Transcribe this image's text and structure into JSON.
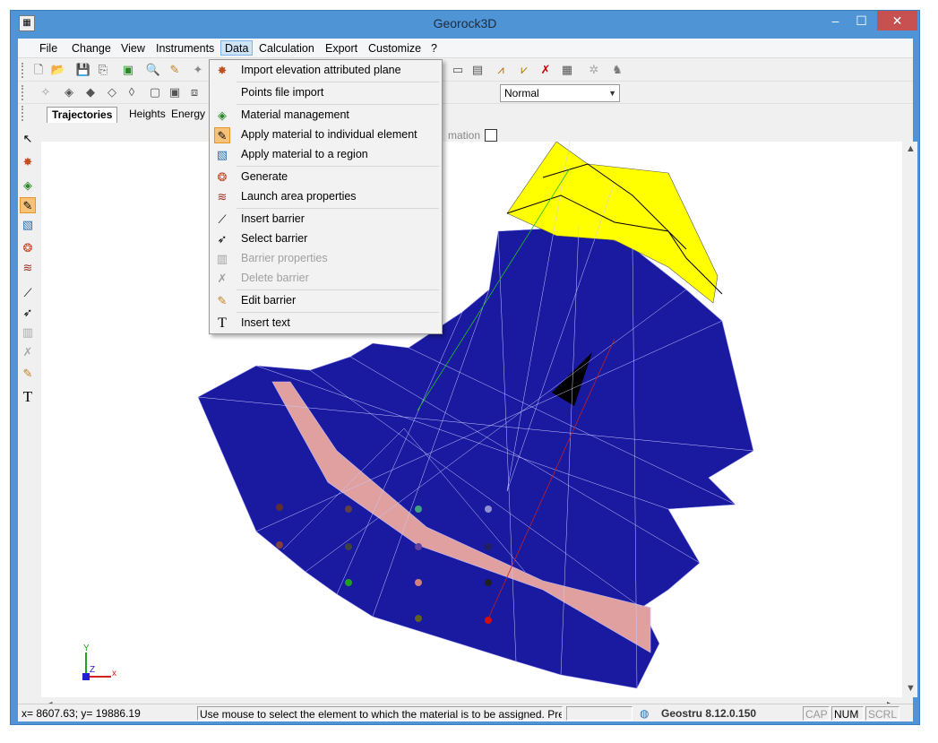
{
  "window": {
    "title": "Georock3D"
  },
  "menubar": [
    "File",
    "Change",
    "View",
    "Instruments",
    "Data",
    "Calculation",
    "Export",
    "Customize",
    "?"
  ],
  "toolbar2": {
    "checkbox_label": "mation",
    "combo_value": "Normal"
  },
  "tabs": [
    "Trajectories",
    "Heights",
    "Energy"
  ],
  "data_menu": {
    "items": [
      {
        "label": "Import elevation attributed plane",
        "icon": "import-plane-icon"
      },
      {
        "label": "Points file import",
        "icon": ""
      },
      {
        "label": "Material management",
        "icon": "material-icon"
      },
      {
        "label": "Apply material to individual element",
        "icon": "apply-element-icon"
      },
      {
        "label": "Apply material to a region",
        "icon": "apply-region-icon"
      },
      {
        "label": "Generate",
        "icon": "generate-icon"
      },
      {
        "label": "Launch area properties",
        "icon": "launch-area-icon"
      },
      {
        "label": "Insert barrier",
        "icon": "insert-barrier-icon"
      },
      {
        "label": "Select barrier",
        "icon": "select-barrier-icon"
      },
      {
        "label": "Barrier properties",
        "icon": "barrier-properties-icon"
      },
      {
        "label": "Delete barrier",
        "icon": "delete-barrier-icon"
      },
      {
        "label": "Edit barrier",
        "icon": "edit-barrier-icon"
      },
      {
        "label": "Insert text",
        "icon": "text-icon"
      }
    ]
  },
  "axes": {
    "y": "Y",
    "z": "Z",
    "x": "x"
  },
  "statusbar": {
    "coords": "x= 8607.63; y= 19886.19",
    "message": "Use mouse to select the element to which the material is to be assigned. Press Ctl fo",
    "brand": "Geostru 8.12.0.150",
    "cap": "CAP",
    "num": "NUM",
    "scrl": "SCRL"
  },
  "colors": {
    "terrain_blue": "#1a1aa0",
    "terrain_yellow": "#ffff00",
    "terrain_pink": "#e0a0a0",
    "title_bar": "#4f95d6"
  }
}
